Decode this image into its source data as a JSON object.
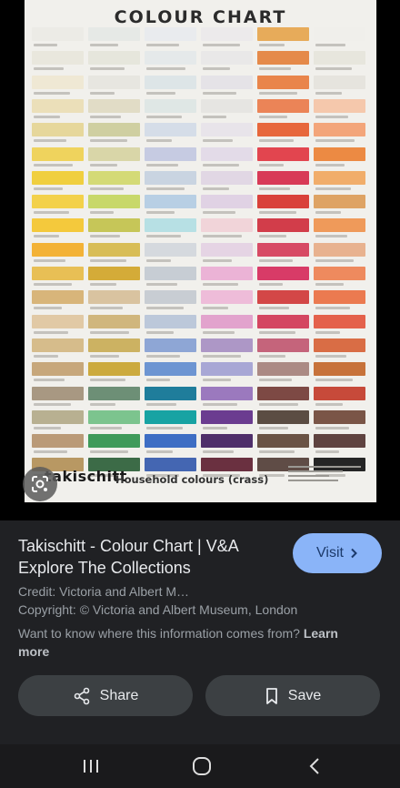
{
  "poster": {
    "title": "COLOUR CHART",
    "brand": "takischitt",
    "subtitle": "Household colours (crass)",
    "columns": [
      [
        "#ecebe6",
        "#e9e7dd",
        "#efe8d4",
        "#ebdfb9",
        "#e6d79b",
        "#efd35d",
        "#f0cf3f",
        "#f3d14a",
        "#f4c93c",
        "#f3b236",
        "#e8bf55",
        "#d8b57a",
        "#e1c9a5",
        "#d6bc8b",
        "#c7a77b",
        "#a89882",
        "#b8b091",
        "#ba9a77",
        "#b89863"
      ],
      [
        "#e6e9e6",
        "#e6e6dc",
        "#e7e6e0",
        "#e1dcc6",
        "#cfcfa1",
        "#d9d6a8",
        "#d4da76",
        "#c8d86a",
        "#c6c658",
        "#d8bd56",
        "#d4ab38",
        "#d9c3a0",
        "#d0b67d",
        "#ccb262",
        "#ccaa3e",
        "#6d8f76",
        "#7cc48e",
        "#3f9a5a",
        "#3c6b47"
      ],
      [
        "#e9ebee",
        "#e5e9ea",
        "#dde5e7",
        "#dfe7e5",
        "#d5dde8",
        "#c6cbe2",
        "#c9d4e1",
        "#b8cfe4",
        "#b7e0e4",
        "#d5d9de",
        "#c7cdd4",
        "#c8cdd3",
        "#bcc8da",
        "#8ea6d5",
        "#6d95d2",
        "#1f7d9b",
        "#18a3a3",
        "#3e6ec4",
        "#4466b2"
      ],
      [
        "#eceaeb",
        "#e9e8e8",
        "#e5e3e7",
        "#e6e5e2",
        "#e8e4ea",
        "#e3dbe8",
        "#e1d7e4",
        "#e0d2e4",
        "#f1d4d9",
        "#e5d4e4",
        "#ebb3d6",
        "#eebcd9",
        "#e2a3cd",
        "#ad97c6",
        "#a8a7d5",
        "#9b79be",
        "#6b3c90",
        "#4f2f6a",
        "#6a3040"
      ],
      [
        "#e7ab5a",
        "#e58a4a",
        "#e9854b",
        "#eb8457",
        "#e7673c",
        "#e2454f",
        "#d83a57",
        "#d9413a",
        "#d23d4a",
        "#d74a64",
        "#d83b67",
        "#d34747",
        "#d44661",
        "#c5647b",
        "#ab8a84",
        "#7d4944",
        "#5b4d43",
        "#6a5345",
        "#5f4c46"
      ],
      [
        "#f0efeb",
        "#e7e6dd",
        "#e6e4de",
        "#f5c8ac",
        "#f3a57a",
        "#ec8a43",
        "#f1ad6a",
        "#dea364",
        "#ef9a5a",
        "#e8b28f",
        "#ee8a5e",
        "#eb7a50",
        "#e4614b",
        "#d96d45",
        "#c7723a",
        "#c74a3a",
        "#7a5547",
        "#5f4340",
        "#252525"
      ]
    ]
  },
  "lens": {
    "icon": "lens-search-icon"
  },
  "result": {
    "title": "Takischitt - Colour Chart | V&A Explore The Collections",
    "visit_label": "Visit",
    "credit": "Credit: Victoria and Albert M…",
    "copyright": "Copyright: © Victoria and Albert Museum, London",
    "info_text": "Want to know where this information comes from?",
    "learn_more": "Learn more",
    "share_label": "Share",
    "save_label": "Save"
  },
  "nav": {
    "recents": "recent-apps-icon",
    "home": "home-icon",
    "back": "back-icon"
  }
}
